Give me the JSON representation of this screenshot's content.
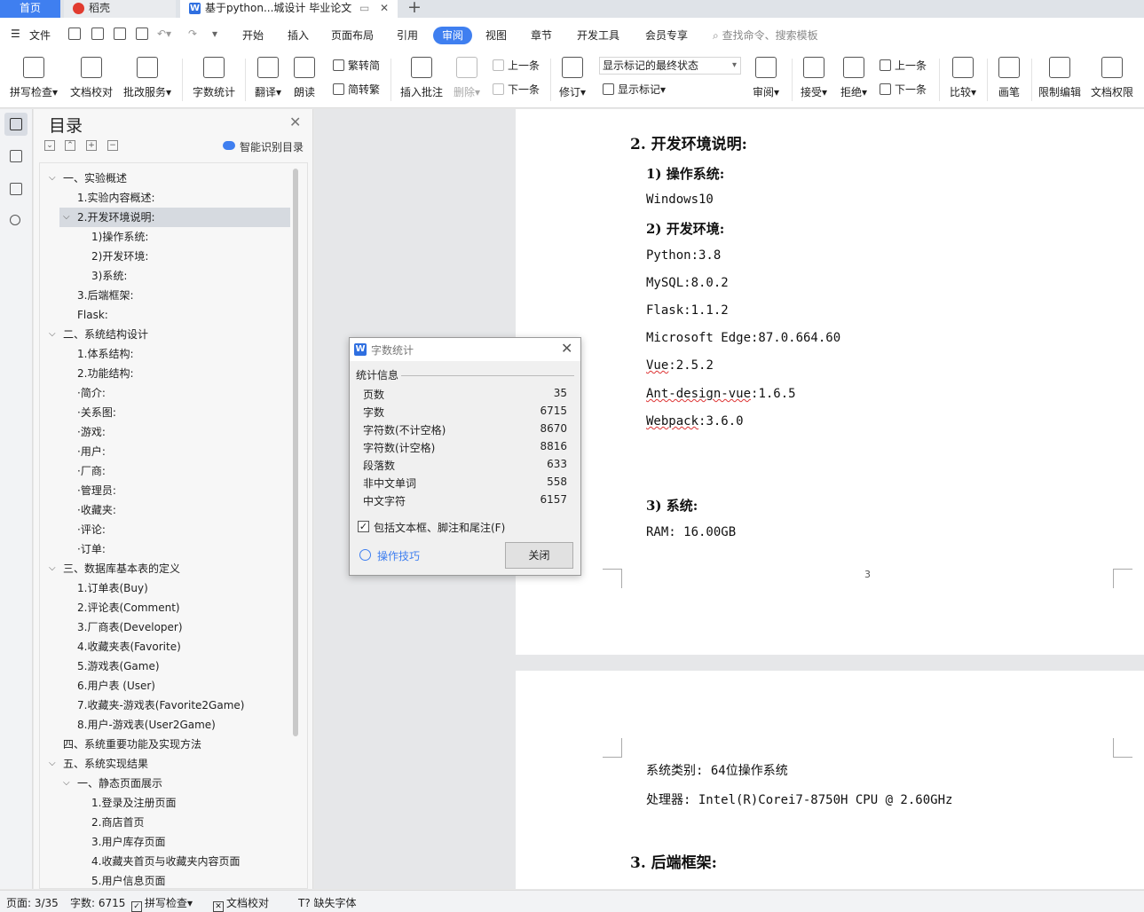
{
  "tabs": {
    "home": "首页",
    "daoke": "稻壳",
    "doc": "基于python...城设计 毕业论文",
    "new_tab": "+"
  },
  "menu": {
    "file": "文件",
    "items": [
      "开始",
      "插入",
      "页面布局",
      "引用",
      "审阅",
      "视图",
      "章节",
      "开发工具",
      "会员专享"
    ],
    "active": "审阅",
    "search_placeholder": "查找命令、搜索模板"
  },
  "ribbon": {
    "spell_check": "拼写检查",
    "doc_proof": "文档校对",
    "batch_service": "批改服务",
    "word_count": "字数统计",
    "translate": "翻译",
    "read_aloud": "朗读",
    "trad_to_simp": "繁转简",
    "simp_to_trad": "简转繁",
    "insert_comment": "插入批注",
    "delete": "删除",
    "prev_comment": "上一条",
    "next_comment": "下一条",
    "revise": "修订",
    "markup_select_value": "显示标记的最终状态",
    "show_markup": "显示标记",
    "review_pane": "审阅",
    "accept": "接受",
    "reject": "拒绝",
    "prev_change": "上一条",
    "next_change": "下一条",
    "compare": "比较",
    "pen": "画笔",
    "restrict_edit": "限制编辑",
    "doc_permission": "文档权限"
  },
  "toc": {
    "title": "目录",
    "smart_label": "智能识别目录",
    "items": [
      {
        "text": "一、实验概述",
        "level": 0,
        "expanded": true
      },
      {
        "text": "1.实验内容概述:",
        "level": 1
      },
      {
        "text": "2.开发环境说明:",
        "level": 1,
        "expanded": true,
        "selected": true
      },
      {
        "text": "1)操作系统:",
        "level": 2
      },
      {
        "text": "2)开发环境:",
        "level": 2
      },
      {
        "text": "3)系统:",
        "level": 2
      },
      {
        "text": "3.后端框架:",
        "level": 1
      },
      {
        "text": "Flask:",
        "level": 1
      },
      {
        "text": "二、系统结构设计",
        "level": 0,
        "expanded": true
      },
      {
        "text": "1.体系结构:",
        "level": 1
      },
      {
        "text": "2.功能结构:",
        "level": 1
      },
      {
        "text": "·简介:",
        "level": 1
      },
      {
        "text": "·关系图:",
        "level": 1
      },
      {
        "text": "·游戏:",
        "level": 1
      },
      {
        "text": "·用户:",
        "level": 1
      },
      {
        "text": "·厂商:",
        "level": 1
      },
      {
        "text": "·管理员:",
        "level": 1
      },
      {
        "text": "·收藏夹:",
        "level": 1
      },
      {
        "text": "·评论:",
        "level": 1
      },
      {
        "text": "·订单:",
        "level": 1
      },
      {
        "text": "三、数据库基本表的定义",
        "level": 0,
        "expanded": true
      },
      {
        "text": "1.订单表(Buy)",
        "level": 1
      },
      {
        "text": "2.评论表(Comment)",
        "level": 1
      },
      {
        "text": "3.厂商表(Developer)",
        "level": 1
      },
      {
        "text": "4.收藏夹表(Favorite)",
        "level": 1
      },
      {
        "text": "5.游戏表(Game)",
        "level": 1
      },
      {
        "text": "6.用户表 (User)",
        "level": 1
      },
      {
        "text": "7.收藏夹-游戏表(Favorite2Game)",
        "level": 1
      },
      {
        "text": "8.用户-游戏表(User2Game)",
        "level": 1
      },
      {
        "text": "四、系统重要功能及实现方法",
        "level": 0
      },
      {
        "text": "五、系统实现结果",
        "level": 0,
        "expanded": true
      },
      {
        "text": "一、静态页面展示",
        "level": 1,
        "expanded": true
      },
      {
        "text": "1.登录及注册页面",
        "level": 2
      },
      {
        "text": "2.商店首页",
        "level": 2
      },
      {
        "text": "3.用户库存页面",
        "level": 2
      },
      {
        "text": "4.收藏夹首页与收藏夹内容页面",
        "level": 2
      },
      {
        "text": "5.用户信息页面",
        "level": 2
      }
    ]
  },
  "document": {
    "page3": {
      "h2_dev_env": "2.  开发环境说明:",
      "h3_os": "1) 操作系统:",
      "os_value": "Windows10",
      "h3_env": "2) 开发环境:",
      "env_lines": [
        {
          "text": "Python:3.8",
          "squiggle": false
        },
        {
          "text": "MySQL:8.0.2",
          "squiggle": false
        },
        {
          "text": "Flask:1.1.2",
          "squiggle": false
        },
        {
          "text": "Microsoft Edge:87.0.664.60",
          "squiggle": false
        },
        {
          "squig": "Vue",
          "rest": ":2.5.2"
        },
        {
          "squig": "Ant-design-vue",
          "rest": ":1.6.5"
        },
        {
          "squig": "Webpack",
          "rest": ":3.6.0"
        }
      ],
      "h3_system": "3) 系统:",
      "ram": "RAM: 16.00GB",
      "page_number": "3"
    },
    "page4": {
      "system_type": "系统类别: 64位操作系统",
      "processor": "处理器: Intel(R)Corei7-8750H CPU @ 2.60GHz",
      "h2_backend": "3.  后端框架:"
    }
  },
  "dialog": {
    "title": "字数统计",
    "section": "统计信息",
    "stats": [
      {
        "label": "页数",
        "value": "35"
      },
      {
        "label": "字数",
        "value": "6715"
      },
      {
        "label": "字符数(不计空格)",
        "value": "8670"
      },
      {
        "label": "字符数(计空格)",
        "value": "8816"
      },
      {
        "label": "段落数",
        "value": "633"
      },
      {
        "label": "非中文单词",
        "value": "558"
      },
      {
        "label": "中文字符",
        "value": "6157"
      }
    ],
    "include_checkbox_label": "包括文本框、脚注和尾注(F)",
    "include_checked": true,
    "tips_link": "操作技巧",
    "close_button": "关闭"
  },
  "statusbar": {
    "page": "页面: 3/35",
    "word_count": "字数: 6715",
    "spell_check": "拼写检查",
    "doc_proof": "文档校对",
    "missing_font": "缺失字体"
  },
  "colors": {
    "accent": "#3f7ff0",
    "spell_error": "#d33"
  }
}
